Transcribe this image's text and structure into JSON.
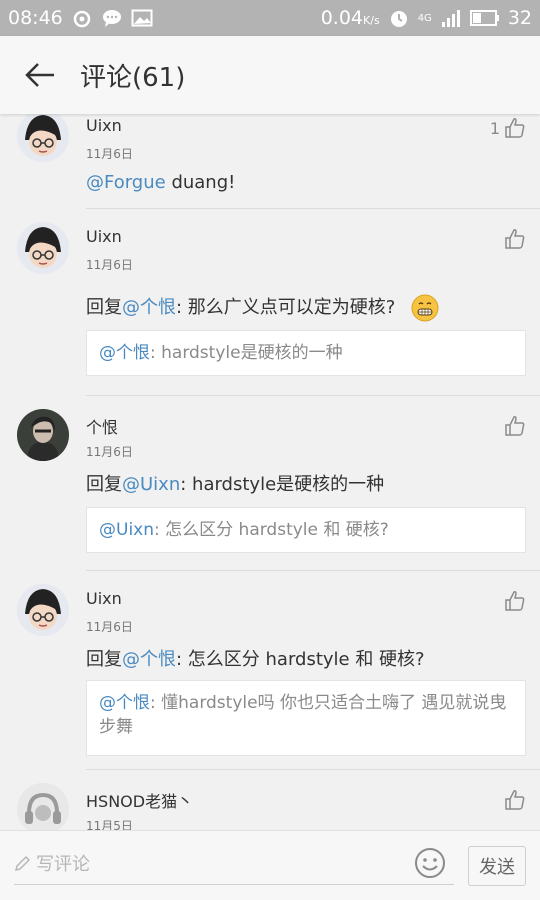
{
  "status_bar": {
    "time": "08:46",
    "net_speed": "0.04",
    "net_unit": "K/s",
    "network_type": "4G",
    "battery": "32"
  },
  "app_bar": {
    "title": "评论(61)"
  },
  "comments": [
    {
      "user": "Uixn",
      "date": "11月6日",
      "likes": "1",
      "mention": "@Forgue",
      "text": " duang!"
    },
    {
      "user": "Uixn",
      "date": "11月6日",
      "likes": "",
      "prefix": "回复",
      "mention": "@个恨",
      "text": ": 那么广义点可以定为硬核?",
      "quote_mention": "@个恨",
      "quote_text": ": hardstyle是硬核的一种"
    },
    {
      "user": "个恨",
      "date": "11月6日",
      "likes": "",
      "prefix": "回复",
      "mention": "@Uixn",
      "text": ": hardstyle是硬核的一种",
      "quote_mention": "@Uixn",
      "quote_text": ": 怎么区分 hardstyle 和 硬核?"
    },
    {
      "user": "Uixn",
      "date": "11月6日",
      "likes": "",
      "prefix": "回复",
      "mention": "@个恨",
      "text": ": 怎么区分 hardstyle 和 硬核?",
      "quote_mention": "@个恨",
      "quote_text": ": 懂hardstyle吗 你也只适合土嗨了 遇见就说曳步舞"
    },
    {
      "user": "HSNOD老猫丶",
      "date": "11月5日",
      "likes": ""
    }
  ],
  "composer": {
    "placeholder": "写评论",
    "send_label": "发送"
  },
  "colors": {
    "status_bar": "#b3b3b3",
    "mention": "#4a8ac0",
    "background": "#f1f1f1"
  }
}
